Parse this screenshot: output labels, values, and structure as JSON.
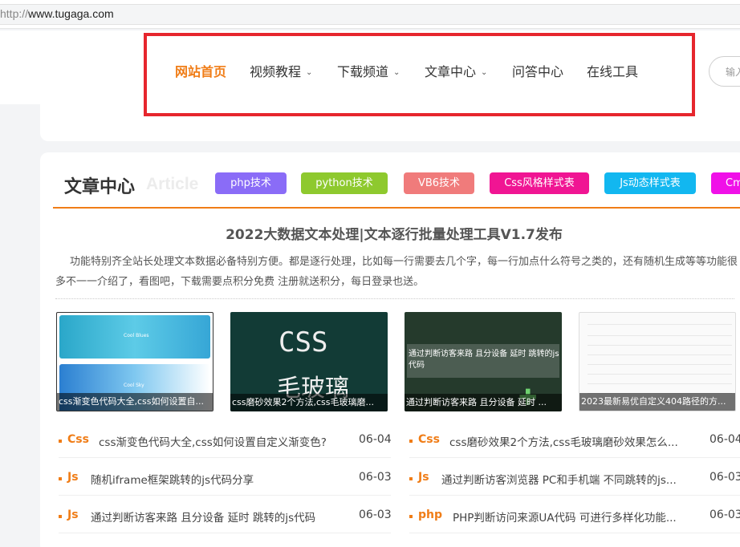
{
  "browser": {
    "url_proto": "http://",
    "url_host": "www.tugaga.com"
  },
  "nav": {
    "items": [
      {
        "label": "网站首页",
        "active": true,
        "dropdown": false
      },
      {
        "label": "视频教程",
        "dropdown": true
      },
      {
        "label": "下载频道",
        "dropdown": true
      },
      {
        "label": "文章中心",
        "dropdown": true
      },
      {
        "label": "问答中心",
        "dropdown": false
      },
      {
        "label": "在线工具",
        "dropdown": false
      }
    ],
    "search_placeholder": "输入"
  },
  "section": {
    "title": "文章中心",
    "title_en": "Article",
    "tags": [
      {
        "label": "php技术",
        "color": "#8a6cf7"
      },
      {
        "label": "python技术",
        "color": "#8ec92e"
      },
      {
        "label": "VB6技术",
        "color": "#f07b7b"
      },
      {
        "label": "Css风格样式表",
        "color": "#f01593"
      },
      {
        "label": "Js动态样式表",
        "color": "#12b7f0"
      },
      {
        "label": "Cm",
        "color": "#f010e8"
      }
    ]
  },
  "featured": {
    "headline": "2022大数据文本处理|文本逐行批量处理工具V1.7发布",
    "summary": "功能特别齐全站长处理文本数据必备特别方便。都是逐行处理，比如每一行需要去几个字，每一行加点什么符号之类的，还有随机生成等等功能很多不一一介绍了，看图吧，下载需要点积分免费 注册就送积分，每日登录也送。"
  },
  "thumbs": [
    {
      "caption": "css渐变色代码大全,css如何设置自...",
      "label_a": "Cool Blues",
      "label_b": "Cool Sky"
    },
    {
      "caption": "css磨砂效果2个方法,css毛玻璃磨...",
      "big1": "CSS",
      "big2": "毛玻璃"
    },
    {
      "caption": "通过判断访客来路 且分设备 延时 ...",
      "board": "通过判断访客来路 且分设备 延时 跳转的js代码"
    },
    {
      "caption": "2023最新易优自定义404路径的方..."
    }
  ],
  "list_left": [
    {
      "cat": "Css",
      "title": "css渐变色代码大全,css如何设置自定义渐变色?",
      "date": "06-04"
    },
    {
      "cat": "Js",
      "title": "随机iframe框架跳转的js代码分享",
      "date": "06-03"
    },
    {
      "cat": "Js",
      "title": "通过判断访客来路 且分设备 延时 跳转的js代码",
      "date": "06-03"
    }
  ],
  "list_right": [
    {
      "cat": "Css",
      "title": "css磨砂效果2个方法,css毛玻璃磨砂效果怎么...",
      "date": "06-04"
    },
    {
      "cat": "Js",
      "title": "通过判断访客浏览器 PC和手机端 不同跳转的js...",
      "date": "06-03"
    },
    {
      "cat": "php",
      "title": "PHP判断访问来源UA代码 可进行多样化功能...",
      "date": "06-03"
    }
  ]
}
